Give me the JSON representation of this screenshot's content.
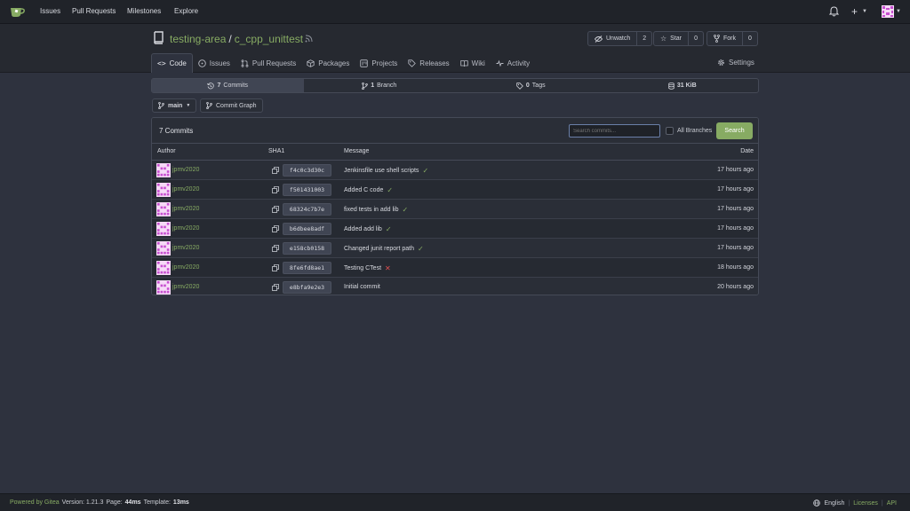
{
  "colors": {
    "accent": "#87ab63",
    "fail": "#e05050",
    "background": "#2e323e"
  },
  "nav": {
    "issues": "Issues",
    "pull_requests": "Pull Requests",
    "milestones": "Milestones",
    "explore": "Explore",
    "plus": "+"
  },
  "repo": {
    "owner": "testing-area",
    "separator": "/",
    "name": "c_cpp_unittest",
    "watch_label": "Unwatch",
    "watch_count": "2",
    "star_label": "Star",
    "star_count": "0",
    "fork_label": "Fork",
    "fork_count": "0"
  },
  "tabs": {
    "code": "Code",
    "issues": "Issues",
    "pull_requests": "Pull Requests",
    "packages": "Packages",
    "projects": "Projects",
    "releases": "Releases",
    "wiki": "Wiki",
    "activity": "Activity",
    "settings": "Settings"
  },
  "stats": {
    "commits_count": "7",
    "commits_label": "Commits",
    "branch_count": "1",
    "branch_label": "Branch",
    "tags_count": "0",
    "tags_label": "Tags",
    "size": "31 KiB"
  },
  "branch": {
    "name": "main",
    "graph_label": "Commit Graph"
  },
  "commits": {
    "title": "7 Commits",
    "search_placeholder": "Search commits...",
    "all_branches": "All Branches",
    "search_button": "Search",
    "columns": {
      "author": "Author",
      "sha": "SHA1",
      "message": "Message",
      "date": "Date"
    },
    "rows": [
      {
        "author": "jpmv2020",
        "sha": "f4c0c3d30c",
        "message": "Jenkinsfile use shell scripts",
        "status": "ok",
        "date": "17 hours ago"
      },
      {
        "author": "jpmv2020",
        "sha": "f501431003",
        "message": "Added C code",
        "status": "ok",
        "date": "17 hours ago"
      },
      {
        "author": "jpmv2020",
        "sha": "68324c7b7e",
        "message": "fixed tests in add lib",
        "status": "ok",
        "date": "17 hours ago"
      },
      {
        "author": "jpmv2020",
        "sha": "b6dbee8adf",
        "message": "Added add lib",
        "status": "ok",
        "date": "17 hours ago"
      },
      {
        "author": "jpmv2020",
        "sha": "e158cb0158",
        "message": "Changed junit report path",
        "status": "ok",
        "date": "17 hours ago"
      },
      {
        "author": "jpmv2020",
        "sha": "8fe6fd8ae1",
        "message": "Testing CTest",
        "status": "fail",
        "date": "18 hours ago"
      },
      {
        "author": "jpmv2020",
        "sha": "e8bfa9e2e3",
        "message": "Initial commit",
        "status": "none",
        "date": "20 hours ago"
      }
    ]
  },
  "footer": {
    "powered": "Powered by Gitea",
    "version": "Version: 1.21.3",
    "page_label": "Page:",
    "page_time": "44ms",
    "template_label": "Template:",
    "template_time": "13ms",
    "language": "English",
    "licenses": "Licenses",
    "api": "API"
  }
}
